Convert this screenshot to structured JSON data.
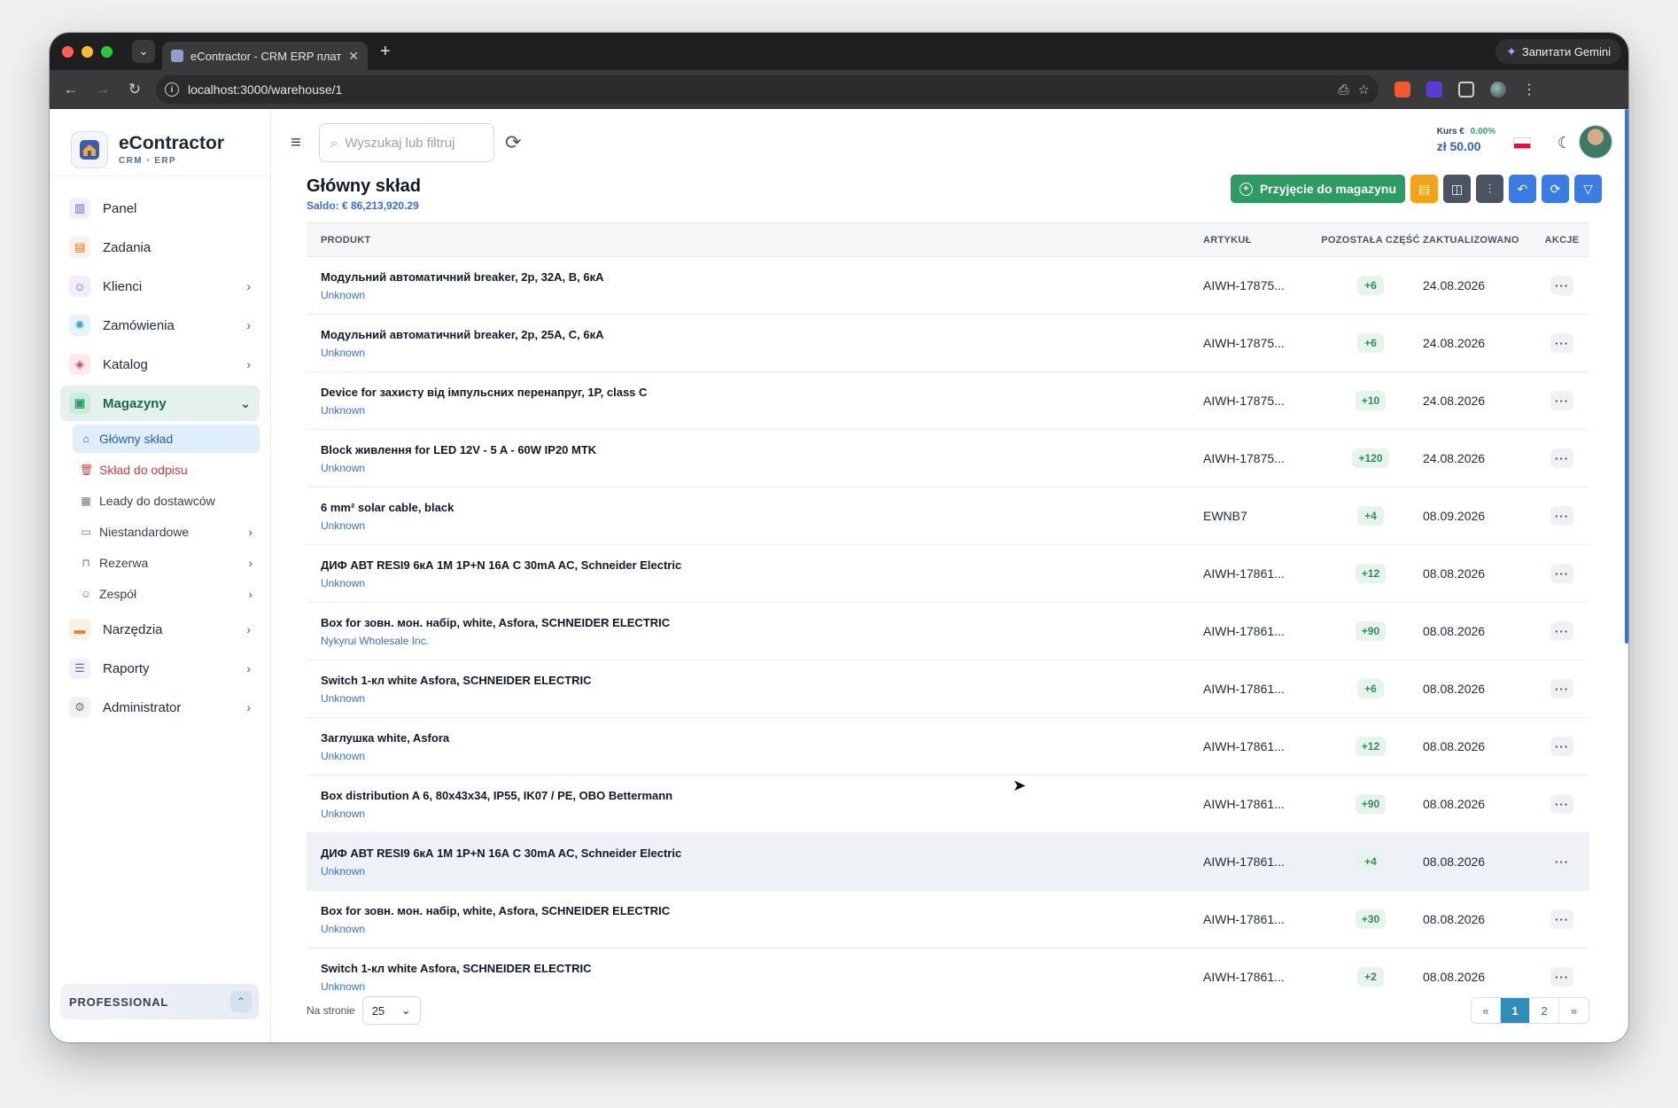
{
  "browser": {
    "tab_title": "eContractor - CRM ERP плат",
    "url": "localhost:3000/warehouse/1",
    "gemini_label": "Запитати Gemini"
  },
  "brand": {
    "title": "eContractor",
    "sub_a": "CRM",
    "sub_b": "ERP"
  },
  "sidebar": {
    "items": [
      {
        "label": "Panel",
        "icon": "chart-icon",
        "color": "#5b6bd6"
      },
      {
        "label": "Zadania",
        "icon": "clipboard-icon",
        "color": "#e07b39"
      },
      {
        "label": "Klienci",
        "icon": "users-icon",
        "color": "#8e5cd6"
      },
      {
        "label": "Zamówienia",
        "icon": "gear-icon",
        "color": "#3aa0c9"
      },
      {
        "label": "Katalog",
        "icon": "box-icon",
        "color": "#d64b5b"
      },
      {
        "label": "Magazyny",
        "icon": "warehouse-icon",
        "color": "#2e9b63"
      },
      {
        "label": "Narzędzia",
        "icon": "toolbox-icon",
        "color": "#d68a2e"
      },
      {
        "label": "Raporty",
        "icon": "report-icon",
        "color": "#5b6bd6"
      },
      {
        "label": "Administrator",
        "icon": "settings-icon",
        "color": "#6b7280"
      }
    ],
    "sub_items": [
      {
        "label": "Główny skład"
      },
      {
        "label": "Skład do odpisu"
      },
      {
        "label": "Leady do dostawców"
      },
      {
        "label": "Niestandardowe"
      },
      {
        "label": "Rezerwa"
      },
      {
        "label": "Zespół"
      }
    ],
    "plan_label": "PROFESSIONAL"
  },
  "topbar": {
    "search_placeholder": "Wyszukaj lub filtruj",
    "rate_label": "Kurs €",
    "rate_change": "0.00%",
    "rate_value": "zł 50.00"
  },
  "page": {
    "title": "Główny skład",
    "saldo": "Saldo: € 86,213,920.29",
    "primary_action": "Przyjęcie do magazynu"
  },
  "table": {
    "headers": {
      "product": "PRODUKT",
      "article": "ARTYKUŁ",
      "remaining": "POZOSTAŁA CZĘŚĆ",
      "updated": "ZAKTUALIZOWANO",
      "actions": "AKCJE"
    },
    "rows": [
      {
        "name": "Модульний автоматичний breaker, 2р, 32А, В, 6кА",
        "supplier": "Unknown",
        "article": "AIWH-17875...",
        "qty": "+6",
        "date": "24.08.2026"
      },
      {
        "name": "Модульний автоматичний breaker, 2р, 25А, С, 6кА",
        "supplier": "Unknown",
        "article": "AIWH-17875...",
        "qty": "+6",
        "date": "24.08.2026"
      },
      {
        "name": "Device for захисту від імпульсних перенапруг, 1P, class C",
        "supplier": "Unknown",
        "article": "AIWH-17875...",
        "qty": "+10",
        "date": "24.08.2026"
      },
      {
        "name": "Block живлення for LED 12V - 5 A - 60W IP20 MTK",
        "supplier": "Unknown",
        "article": "AIWH-17875...",
        "qty": "+120",
        "date": "24.08.2026"
      },
      {
        "name": "6 mm² solar cable, black",
        "supplier": "Unknown",
        "article": "EWNB7",
        "qty": "+4",
        "date": "08.09.2026"
      },
      {
        "name": "ДИФ АВТ RESI9 6кА 1М 1Р+N 16А С 30mA AC, Schneider Electric",
        "supplier": "Unknown",
        "article": "AIWH-17861...",
        "qty": "+12",
        "date": "08.08.2026"
      },
      {
        "name": "Box for зовн. мон. набір, white, Asfora, SCHNEIDER ELECTRIC",
        "supplier": "Nykyrui Wholesale Inc.",
        "article": "AIWH-17861...",
        "qty": "+90",
        "date": "08.08.2026"
      },
      {
        "name": "Switch 1-кл white Asfora, SCHNEIDER ELECTRIC",
        "supplier": "Unknown",
        "article": "AIWH-17861...",
        "qty": "+6",
        "date": "08.08.2026"
      },
      {
        "name": "Заглушка white, Asfora",
        "supplier": "Unknown",
        "article": "AIWH-17861...",
        "qty": "+12",
        "date": "08.08.2026"
      },
      {
        "name": "Box distribution A 6, 80x43x34, IP55, IK07 / PE, OBO Bettermann",
        "supplier": "Unknown",
        "article": "AIWH-17861...",
        "qty": "+90",
        "date": "08.08.2026"
      },
      {
        "name": "ДИФ АВТ RESI9 6кА 1М 1Р+N 16А С 30mA AC, Schneider Electric",
        "supplier": "Unknown",
        "article": "AIWH-17861...",
        "qty": "+4",
        "date": "08.08.2026"
      },
      {
        "name": "Box for зовн. мон. набір, white, Asfora, SCHNEIDER ELECTRIC",
        "supplier": "Unknown",
        "article": "AIWH-17861...",
        "qty": "+30",
        "date": "08.08.2026"
      },
      {
        "name": "Switch 1-кл white Asfora, SCHNEIDER ELECTRIC",
        "supplier": "Unknown",
        "article": "AIWH-17861...",
        "qty": "+2",
        "date": "08.08.2026"
      }
    ]
  },
  "footer": {
    "per_page_label": "Na stronie",
    "per_page_value": "25",
    "pages": [
      "«",
      "1",
      "2",
      "»"
    ]
  }
}
